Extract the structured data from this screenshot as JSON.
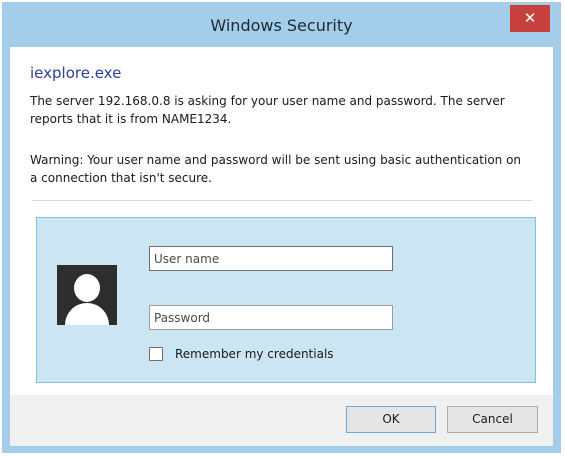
{
  "window": {
    "title": "Windows Security",
    "close_label": "✕"
  },
  "dialog": {
    "app_name": "iexplore.exe",
    "server_message": "The server 192.168.0.8 is asking for your user name and password. The server reports that it is from NAME1234.",
    "warning_message": "Warning: Your user name and password will be sent using basic authentication on a connection that isn't secure."
  },
  "credentials": {
    "avatar_icon": "user-silhouette-icon",
    "username_placeholder": "User name",
    "password_placeholder": "Password",
    "remember_label": "Remember my credentials",
    "remember_checked": false
  },
  "buttons": {
    "ok_label": "OK",
    "cancel_label": "Cancel"
  },
  "colors": {
    "frame": "#a3cde8",
    "close_button": "#c6403d",
    "app_name": "#2a3f9a",
    "credential_panel": "#cbe6f2"
  }
}
